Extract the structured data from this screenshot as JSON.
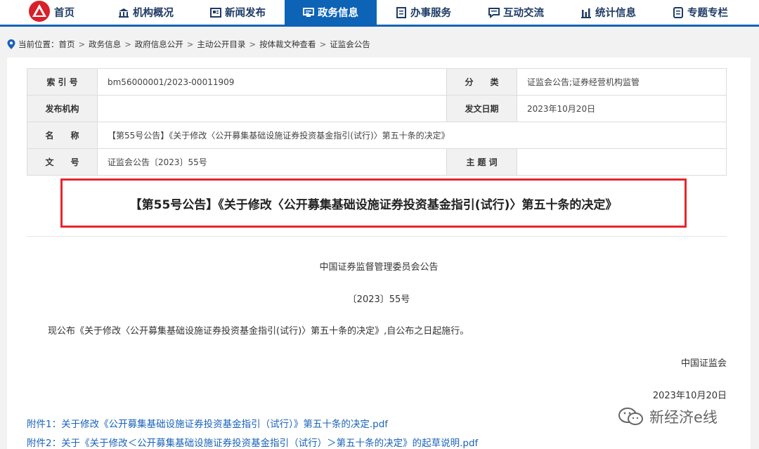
{
  "nav": {
    "items": [
      {
        "label": "首页",
        "icon": "home-logo-icon"
      },
      {
        "label": "机构概况",
        "icon": "building-icon"
      },
      {
        "label": "新闻发布",
        "icon": "news-icon"
      },
      {
        "label": "政务信息",
        "icon": "monitor-icon",
        "active": true
      },
      {
        "label": "办事服务",
        "icon": "document-list-icon"
      },
      {
        "label": "互动交流",
        "icon": "chat-icon"
      },
      {
        "label": "统计信息",
        "icon": "bar-chart-icon"
      },
      {
        "label": "专题专栏",
        "icon": "file-icon"
      }
    ],
    "active_color": "#0d63b6"
  },
  "breadcrumb": {
    "prefix": "当前位置：",
    "items": [
      "首页",
      "政务信息",
      "政府信息公开",
      "主动公开目录",
      "按体裁文种查看",
      "证监会公告"
    ],
    "separator": ">"
  },
  "meta": {
    "index_label": "索 引 号",
    "index_value": "bm56000001/2023-00011909",
    "category_label": "分　　类",
    "category_value": "证监会公告;证券经营机构监管",
    "issuer_label": "发布机构",
    "issuer_value": "",
    "date_label": "发文日期",
    "date_value": "2023年10月20日",
    "name_label": "名　　称",
    "name_value": "【第55号公告】《关于修改〈公开募集基础设施证券投资基金指引(试行)〉第五十条的决定》",
    "docno_label": "文　　号",
    "docno_value": "证监会公告〔2023〕55号",
    "keyword_label": "主 题 词",
    "keyword_value": ""
  },
  "title": "【第55号公告】《关于修改〈公开募集基础设施证券投资基金指引(试行)〉第五十条的决定》",
  "document": {
    "issuer": "中国证券监督管理委员会公告",
    "number": "〔2023〕55号",
    "body": "现公布《关于修改〈公开募集基础设施证券投资基金指引(试行)〉第五十条的决定》,自公布之日起施行。",
    "signature": "中国证监会",
    "date": "2023年10月20日"
  },
  "attachments": [
    "附件1：关于修改《公开募集基础设施证券投资基金指引（试行）》第五十条的决定.pdf",
    "附件2：关于《关于修改＜公开募集基础设施证券投资基金指引（试行）＞第五十条的决定》的起草说明.pdf"
  ],
  "watermark": "新经济e线",
  "colors": {
    "highlight_border": "#e8262d",
    "link": "#1a63b8"
  }
}
